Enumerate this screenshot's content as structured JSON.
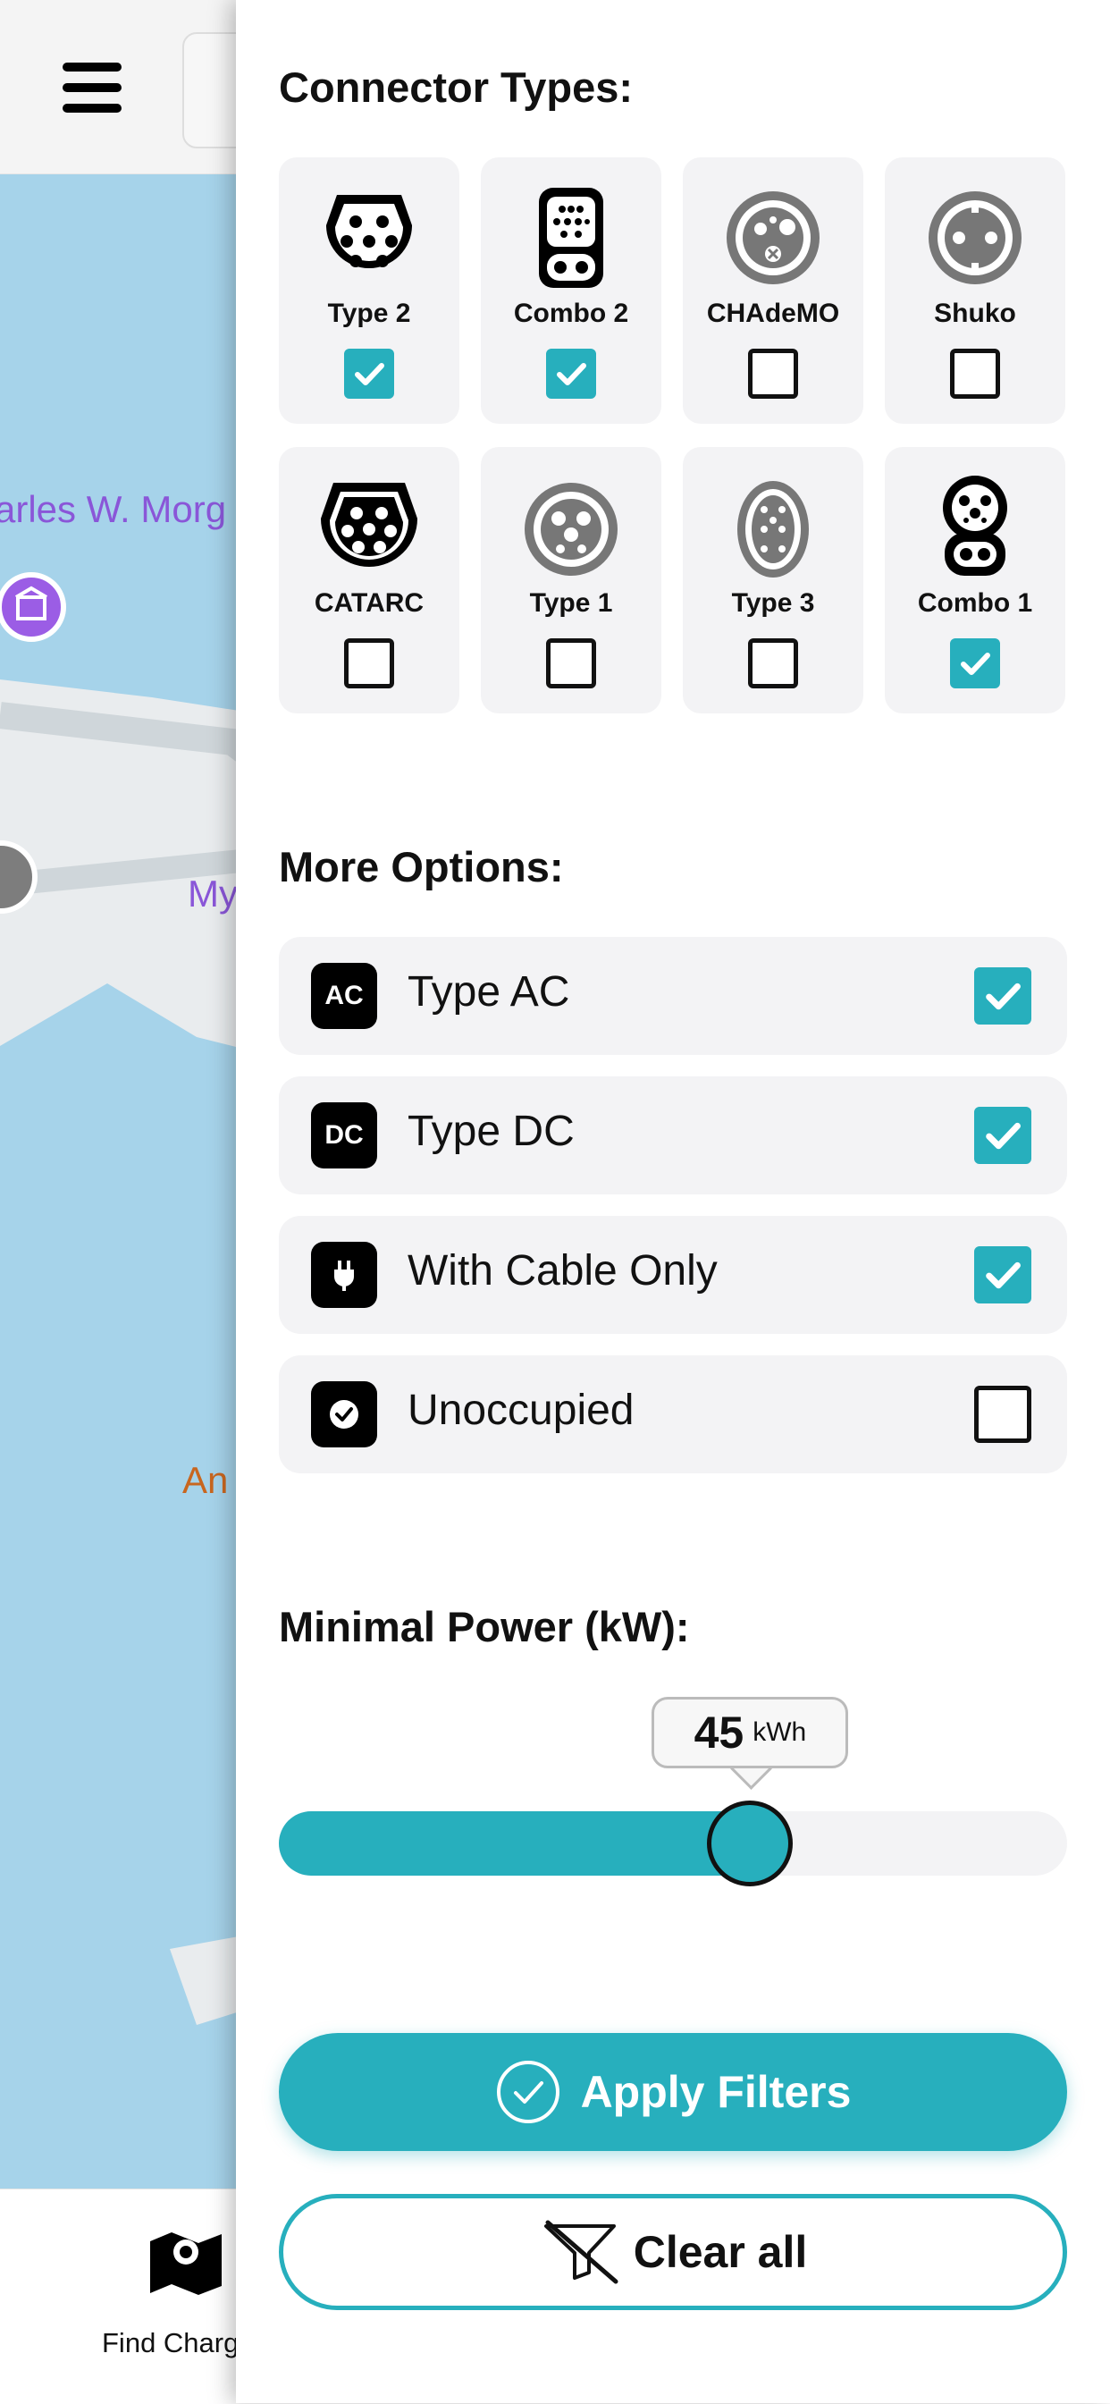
{
  "map": {
    "labels": [
      "arles W. Morg",
      "My",
      "An"
    ],
    "bottom_tab": {
      "label": "Find Charg"
    }
  },
  "filters": {
    "connector_section_title": "Connector Types:",
    "connectors": [
      {
        "label": "Type 2",
        "checked": true,
        "icon": "type2-connector-icon"
      },
      {
        "label": "Combo 2",
        "checked": true,
        "icon": "combo2-connector-icon"
      },
      {
        "label": "CHAdeMO",
        "checked": false,
        "icon": "chademo-connector-icon"
      },
      {
        "label": "Shuko",
        "checked": false,
        "icon": "shuko-connector-icon"
      },
      {
        "label": "CATARC",
        "checked": false,
        "icon": "catarc-connector-icon"
      },
      {
        "label": "Type 1",
        "checked": false,
        "icon": "type1-connector-icon"
      },
      {
        "label": "Type 3",
        "checked": false,
        "icon": "type3-connector-icon"
      },
      {
        "label": "Combo 1",
        "checked": true,
        "icon": "combo1-connector-icon"
      }
    ],
    "options_section_title": "More Options:",
    "options": [
      {
        "badge": "AC",
        "label": "Type AC",
        "checked": true
      },
      {
        "badge": "DC",
        "label": "Type DC",
        "checked": true
      },
      {
        "badge": "plug-icon",
        "label": "With Cable Only",
        "checked": true
      },
      {
        "badge": "check-circle-icon",
        "label": "Unoccupied",
        "checked": false
      }
    ],
    "power_section_title": "Minimal Power (kW):",
    "power": {
      "value": "45",
      "unit": "kWh",
      "fraction": 0.598
    },
    "apply_label": "Apply Filters",
    "clear_label": "Clear all"
  },
  "colors": {
    "accent": "#27afbd",
    "map_water": "#a6d3ea",
    "card_bg": "#f3f3f5"
  }
}
